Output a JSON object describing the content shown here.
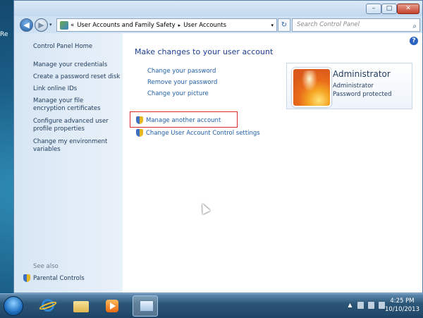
{
  "desktop": {
    "label": "Re"
  },
  "window": {
    "controls": {
      "minimize": "–",
      "maximize": "□",
      "close": "✕"
    },
    "address": {
      "chevron": "«",
      "segments": [
        "User Accounts and Family Safety",
        "User Accounts"
      ],
      "separator": "▸",
      "dropdown": "▾",
      "refresh": "↻"
    },
    "search": {
      "placeholder": "Search Control Panel",
      "icon": "⌕"
    }
  },
  "sidebar": {
    "home": "Control Panel Home",
    "links": [
      "Manage your credentials",
      "Create a password reset disk",
      "Link online IDs",
      "Manage your file encryption certificates",
      "Configure advanced user profile properties",
      "Change my environment variables"
    ],
    "see_also": "See also",
    "parental": "Parental Controls"
  },
  "main": {
    "title": "Make changes to your user account",
    "help": "?",
    "links": [
      "Change your password",
      "Remove your password",
      "Change your picture"
    ],
    "admin_links": [
      "Manage another account",
      "Change User Account Control settings"
    ],
    "account": {
      "name": "Administrator",
      "type": "Administrator",
      "status": "Password protected"
    }
  },
  "taskbar": {
    "tray_arrow": "▲",
    "time": "4:25 PM",
    "date": "10/10/2013"
  },
  "colors": {
    "link": "#1f5ea8",
    "highlight_border": "#d42a2a",
    "title": "#1e3d8c"
  }
}
